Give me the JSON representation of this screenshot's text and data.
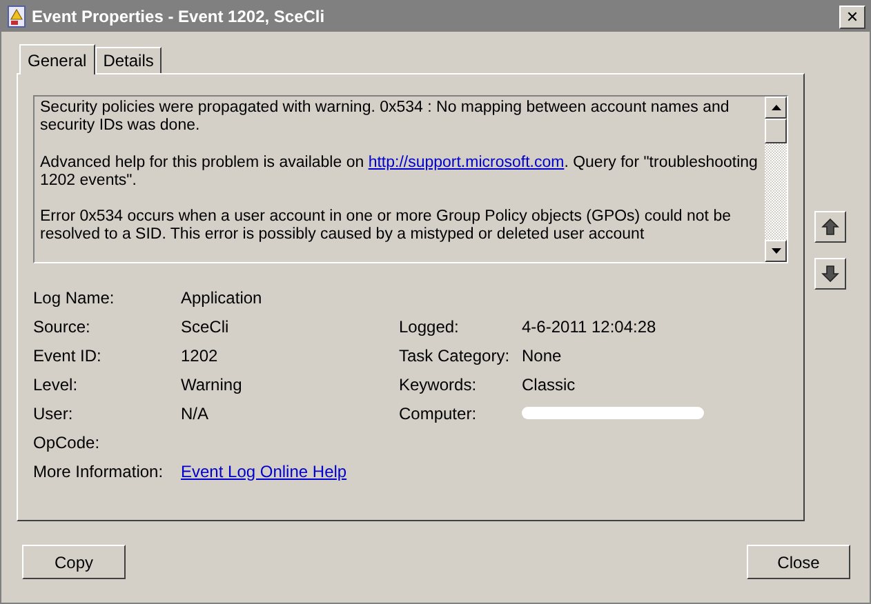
{
  "window": {
    "title": "Event Properties - Event 1202, SceCli",
    "close": "✕"
  },
  "tabs": [
    {
      "label": "General",
      "selected": true
    },
    {
      "label": "Details",
      "selected": false
    }
  ],
  "description": [
    {
      "text": "Security policies were propagated with warning. 0x534 : No mapping between account names and security IDs was done."
    },
    {
      "text": "Advanced help for this problem is available on ",
      "link": "http://support.microsoft.com",
      "after": ". Query for \"troubleshooting 1202 events\"."
    },
    {
      "text": "Error 0x534 occurs when a user account in one or more Group Policy objects (GPOs) could not be resolved to a SID.  This error is possibly caused by a mistyped or deleted user account"
    }
  ],
  "fields": [
    {
      "label": "Log Name:",
      "value": "Application"
    },
    {
      "label": "Source:",
      "value": "SceCli",
      "right_label": "Logged:",
      "right_value": "4-6-2011 12:04:28"
    },
    {
      "label": "Event ID:",
      "value": "1202",
      "right_label": "Task Category:",
      "right_value": "None"
    },
    {
      "label": "Level:",
      "value": "Warning",
      "right_label": "Keywords:",
      "right_value": "Classic"
    },
    {
      "label": "User:",
      "value": "N/A",
      "right_label": "Computer:",
      "right_redacted": true
    },
    {
      "label": "OpCode:"
    },
    {
      "label": "More Information:",
      "link": "Event Log Online Help"
    }
  ],
  "buttons": [
    {
      "label": "Copy"
    },
    {
      "label": "Close"
    }
  ]
}
